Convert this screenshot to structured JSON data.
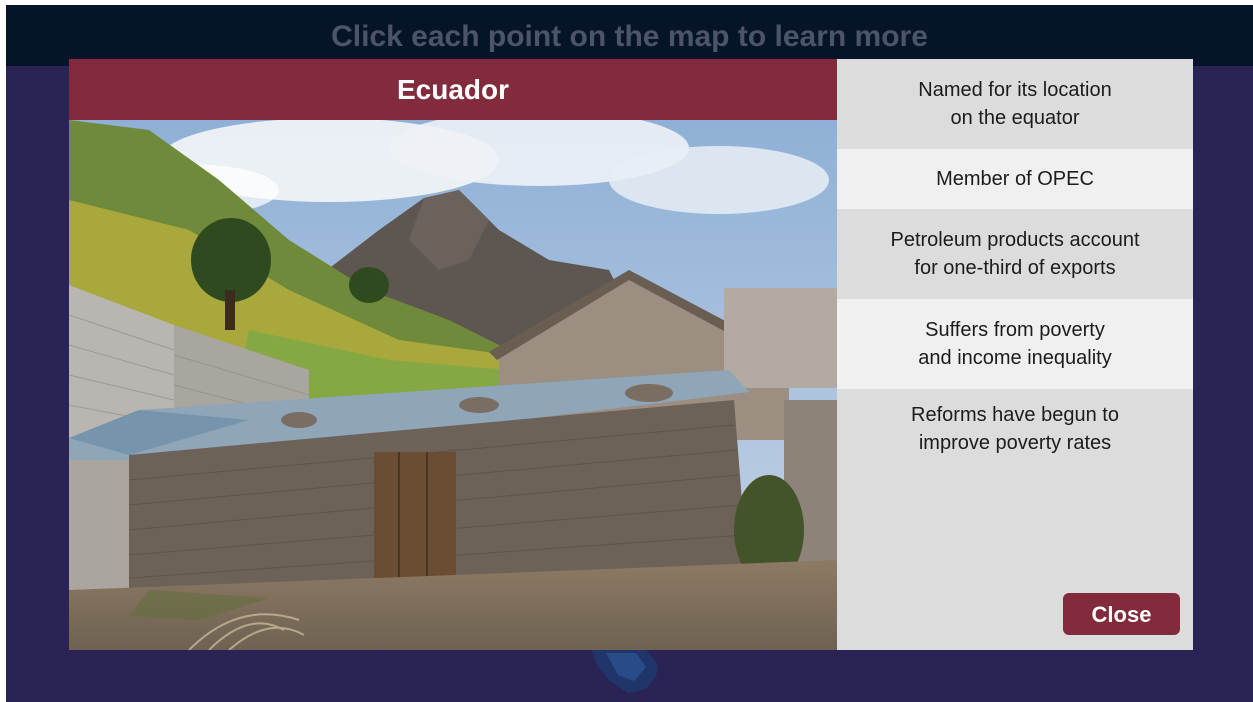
{
  "header": {
    "instruction": "Click each point on the map to learn more"
  },
  "popup": {
    "title": "Ecuador",
    "photo_icon": "village-photo",
    "facts": [
      "Named for its location\non the equator",
      "Member of OPEC",
      "Petroleum products account\nfor one-third of exports",
      "Suffers from poverty\nand income inequality",
      "Reforms have begun to\nimprove poverty rates"
    ],
    "close_label": "Close"
  },
  "colors": {
    "banner": "#06142a",
    "background": "#2a2356",
    "accent": "#822b3c",
    "panel": "#dcdcdc",
    "panel_alt": "#f0f0f0"
  }
}
